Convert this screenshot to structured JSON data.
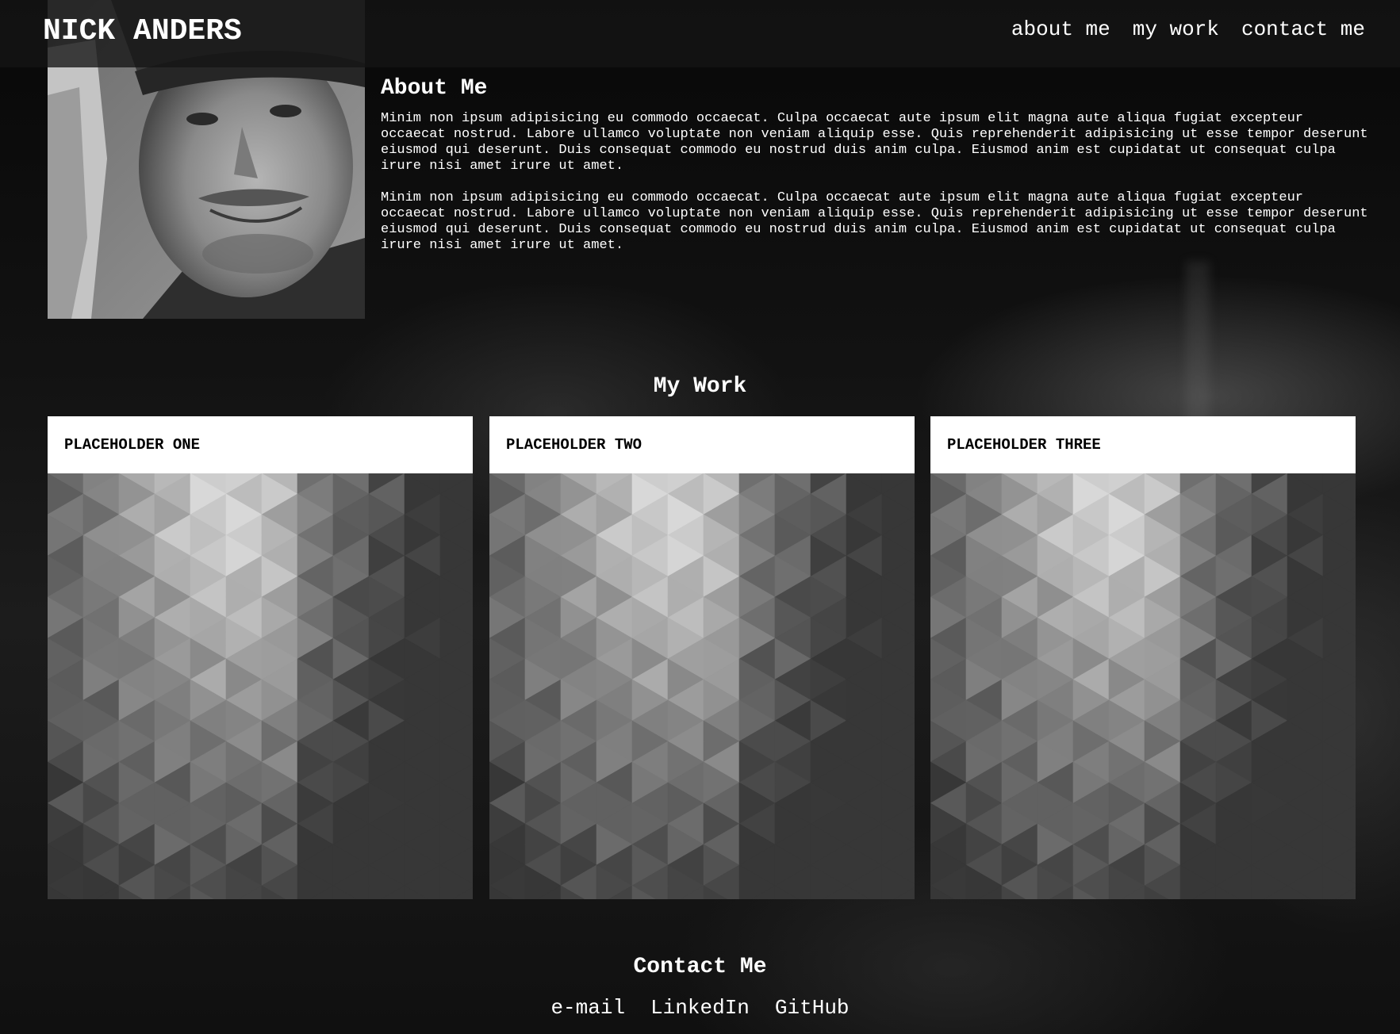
{
  "header": {
    "brand": "NICK ANDERS",
    "nav": [
      "about me",
      "my work",
      "contact me"
    ]
  },
  "about": {
    "title": "About Me",
    "paragraphs": [
      "Minim non ipsum adipisicing eu commodo occaecat. Culpa occaecat aute ipsum elit magna aute aliqua fugiat excepteur occaecat nostrud. Labore ullamco voluptate non veniam aliquip esse. Quis reprehenderit adipisicing ut esse tempor deserunt eiusmod qui deserunt. Duis consequat commodo eu nostrud duis anim culpa. Eiusmod anim est cupidatat ut consequat culpa irure nisi amet irure ut amet.",
      "Minim non ipsum adipisicing eu commodo occaecat. Culpa occaecat aute ipsum elit magna aute aliqua fugiat excepteur occaecat nostrud. Labore ullamco voluptate non veniam aliquip esse. Quis reprehenderit adipisicing ut esse tempor deserunt eiusmod qui deserunt. Duis consequat commodo eu nostrud duis anim culpa. Eiusmod anim est cupidatat ut consequat culpa irure nisi amet irure ut amet."
    ]
  },
  "work": {
    "title": "My Work",
    "projects": [
      {
        "label": "PLACEHOLDER ONE"
      },
      {
        "label": "PLACEHOLDER TWO"
      },
      {
        "label": "PLACEHOLDER THREE"
      }
    ]
  },
  "contact": {
    "title": "Contact Me",
    "links": [
      "e-mail",
      "LinkedIn",
      "GitHub"
    ]
  }
}
